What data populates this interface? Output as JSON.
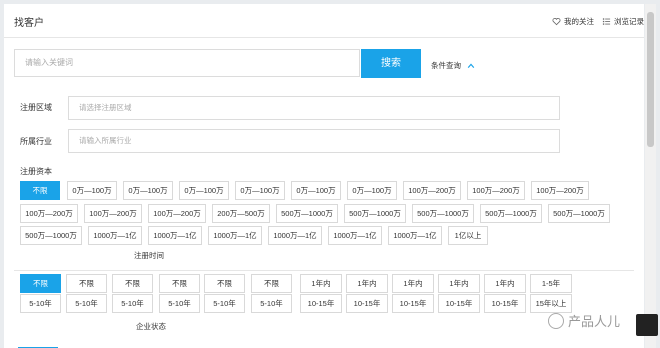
{
  "header": {
    "title": "找客户",
    "my_follow": "我的关注",
    "browse_history": "浏览记录"
  },
  "search": {
    "placeholder": "请输入关键词",
    "button": "搜索",
    "conditions": "条件查询"
  },
  "filters": {
    "region_label": "注册区域",
    "region_placeholder": "请选择注册区域",
    "industry_label": "所属行业",
    "industry_placeholder": "请输入所属行业",
    "capital_label": "注册资本",
    "capital_row1": [
      "不限",
      "0万—100万",
      "0万—100万",
      "0万—100万",
      "0万—100万",
      "0万—100万",
      "0万—100万",
      "100万—200万",
      "100万—200万",
      "100万—200万"
    ],
    "capital_row2": [
      "100万—200万",
      "100万—200万",
      "100万—200万",
      "200万—500万",
      "500万—1000万",
      "500万—1000万",
      "500万—1000万",
      "500万—1000万",
      "500万—1000万"
    ],
    "capital_row3": [
      "500万—1000万",
      "1000万—1亿",
      "1000万—1亿",
      "1000万—1亿",
      "1000万—1亿",
      "1000万—1亿",
      "1000万—1亿",
      "1亿以上"
    ],
    "time_label": "注册时间",
    "time_row1": [
      "不限",
      "不限",
      "不限",
      "不限",
      "不限",
      "不限",
      "1年内",
      "1年内",
      "1年内",
      "1年内",
      "1年内",
      "1-5年"
    ],
    "time_row2": [
      "5-10年",
      "5-10年",
      "5-10年",
      "5-10年",
      "5-10年",
      "5-10年",
      "10-15年",
      "10-15年",
      "10-15年",
      "10-15年",
      "10-15年",
      "15年以上"
    ],
    "status_label": "企业状态"
  },
  "watermark": "产品人儿"
}
